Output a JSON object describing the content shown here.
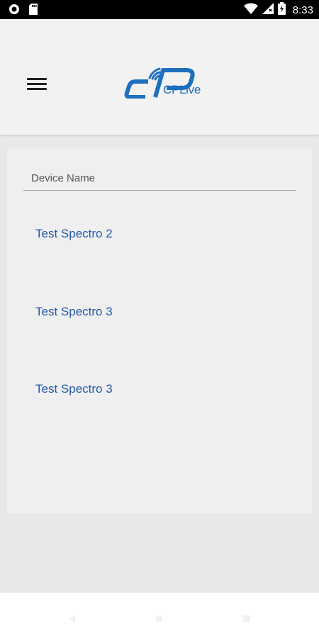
{
  "status_bar": {
    "time": "8:33",
    "left_icons": [
      "record-icon",
      "sd-card-icon"
    ],
    "right_icons": [
      "wifi-icon",
      "signal-icon",
      "battery-icon"
    ]
  },
  "header": {
    "menu_icon": "hamburger-menu-icon",
    "logo_text": "CPLive",
    "brand_color": "#1e6fc0"
  },
  "device_list": {
    "field_label": "Device Name",
    "items": [
      {
        "name": "Test Spectro 2"
      },
      {
        "name": "Test Spectro 3"
      },
      {
        "name": "Test Spectro 3"
      }
    ],
    "item_color": "#2358a8"
  }
}
